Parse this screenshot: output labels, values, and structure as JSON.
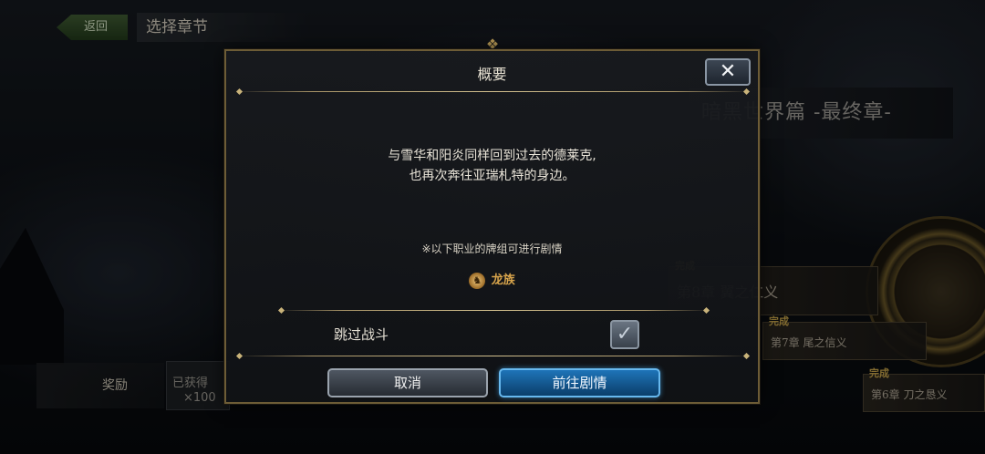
{
  "top_bar": {
    "back_label": "返回",
    "title": "选择章节"
  },
  "background": {
    "world_title": "暗黑世界篇 -最终章-",
    "chapters": [
      {
        "badge": "完成",
        "label": "第8章 翼之仁义"
      },
      {
        "badge": "完成",
        "label": "第7章 尾之信义"
      },
      {
        "badge": "完成",
        "label": "第6章 刀之恳义"
      }
    ],
    "reward_label": "奖励",
    "reward_status": "已获得",
    "reward_count": "×100"
  },
  "modal": {
    "title": "概要",
    "close_symbol": "✕",
    "description_line1": "与雪华和阳炎同样回到过去的德莱克,",
    "description_line2": "也再次奔往亚瑞札特的身边。",
    "note": "※以下职业的牌组可进行剧情",
    "class_icon_glyph": "♞",
    "class_name": "龙族",
    "skip_battle_label": "跳过战斗",
    "checkbox_mark": "✓",
    "cancel_label": "取消",
    "go_label": "前往剧情"
  },
  "colors": {
    "frame_gold": "#6d5c36",
    "confirm_blue": "#1e74b8",
    "class_orange": "#d6a34b"
  }
}
